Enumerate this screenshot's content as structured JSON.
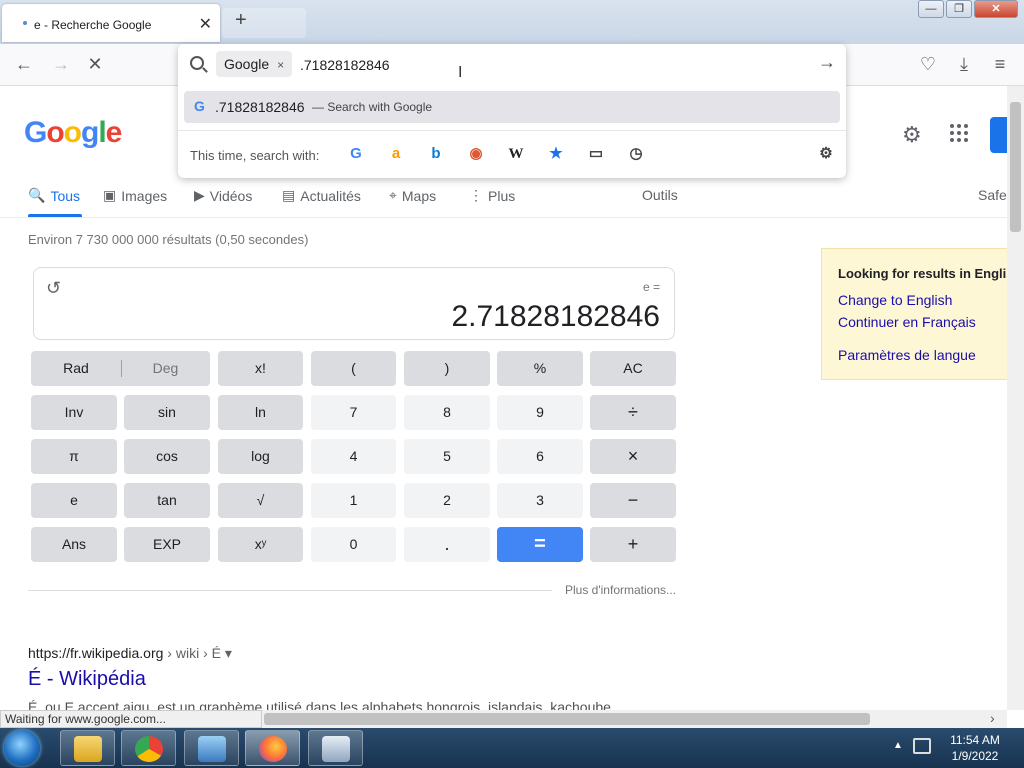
{
  "browser": {
    "tab_title": "e - Recherche Google",
    "tab_close": "✕",
    "new_tab": "+",
    "win_minimize": "—",
    "win_restore": "❐",
    "win_close": "✕"
  },
  "nav": {
    "back": "←",
    "forward": "→",
    "stop": "✕",
    "pocket": "♡",
    "download": "⤓",
    "menu": "≡"
  },
  "urlbar": {
    "engine_chip": "Google",
    "engine_chip_close": "×",
    "query": ".71828182846",
    "go": "→",
    "suggestion_query": ".71828182846",
    "suggestion_hint": "— Search with Google",
    "oneoff_label": "This time, search with:"
  },
  "google": {
    "logo": [
      "G",
      "o",
      "o",
      "g",
      "l",
      "e"
    ],
    "logo_colors": [
      "#4285f4",
      "#ea4335",
      "#fbbc05",
      "#4285f4",
      "#34a853",
      "#ea4335"
    ],
    "tabs": [
      {
        "label": "Tous",
        "icon": "🔍"
      },
      {
        "label": "Images",
        "icon": "▣"
      },
      {
        "label": "Vidéos",
        "icon": "▶"
      },
      {
        "label": "Actualités",
        "icon": "▤"
      },
      {
        "label": "Maps",
        "icon": "⌖"
      },
      {
        "label": "Plus",
        "icon": "⋮"
      }
    ],
    "tools": "Outils",
    "safesearch": "Safe",
    "result_stats": "Environ 7 730 000 000 résultats (0,50 secondes)"
  },
  "calculator": {
    "expression": "e =",
    "result": "2.71828182846",
    "history_icon": "↺",
    "rad": "Rad",
    "deg": "Deg",
    "rows": [
      [
        "x!",
        "(",
        ")",
        "%",
        "AC"
      ],
      [
        "Inv",
        "sin",
        "ln",
        "7",
        "8",
        "9",
        "÷"
      ],
      [
        "π",
        "cos",
        "log",
        "4",
        "5",
        "6",
        "×"
      ],
      [
        "e",
        "tan",
        "√",
        "1",
        "2",
        "3",
        "−"
      ],
      [
        "Ans",
        "EXP",
        "xʸ",
        "0",
        ".",
        "=",
        "+"
      ]
    ],
    "more_info": "Plus d'informations..."
  },
  "result": {
    "cite_url": "https://fr.wikipedia.org",
    "cite_crumbs": " › wiki › É",
    "cite_menu": "▾",
    "title": "É - Wikipédia",
    "snippet": "É, ou E accent aigu, est un graphème utilisé dans les alphabets hongrois, islandais, kachoube, ..."
  },
  "language_box": {
    "heading": "Looking for results in English?",
    "change_english": "Change to English",
    "continue_french": "Continuer en Français",
    "lang_settings": "Paramètres de langue"
  },
  "status": {
    "text": "Waiting for www.google.com..."
  },
  "taskbar": {
    "time": "11:54 AM",
    "date": "1/9/2022"
  }
}
